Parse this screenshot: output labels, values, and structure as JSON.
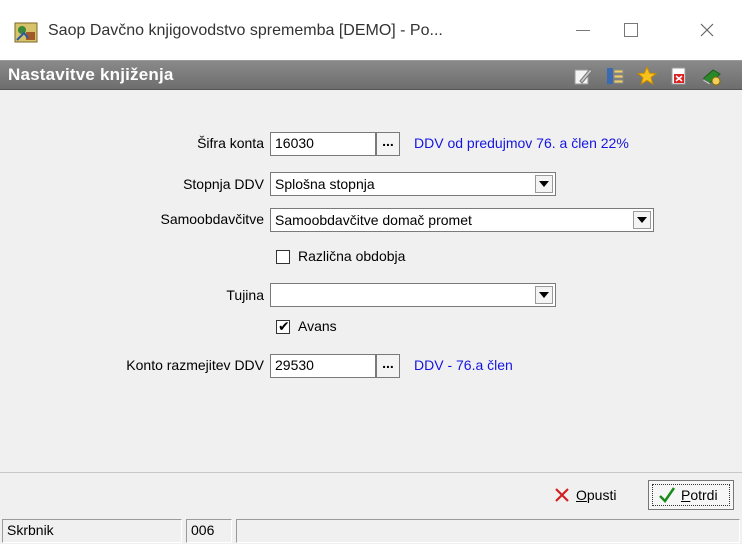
{
  "window": {
    "title": "Saop Davčno knjigovodstvo sprememba [DEMO] - Po...",
    "app_icon": "saop-app-icon"
  },
  "header": {
    "title": "Nastavitve knjiženja",
    "icons": [
      "edit-note-icon",
      "table-columns-icon",
      "favorite-star-icon",
      "export-pdf-icon",
      "help-book-icon"
    ]
  },
  "form": {
    "sifra_konta": {
      "label": "Šifra konta",
      "value": "16030",
      "info": "DDV od predujmov 76. a člen  22%"
    },
    "stopnja_ddv": {
      "label": "Stopnja DDV",
      "value": "Splošna stopnja"
    },
    "samoobdavcitve": {
      "label": "Samoobdavčitve",
      "value": "Samoobdavčitve domač promet"
    },
    "razlicna_obdobja": {
      "label": "Različna obdobja",
      "checked": false
    },
    "tujina": {
      "label": "Tujina",
      "value": ""
    },
    "avans": {
      "label": "Avans",
      "checked": true,
      "mark": "✔"
    },
    "konto_razmejitev": {
      "label": "Konto razmejitev DDV",
      "value": "29530",
      "info": "DDV - 76.a člen"
    },
    "ellipsis": "..."
  },
  "buttons": {
    "cancel": "Opusti",
    "ok": "Potrdi"
  },
  "status": {
    "user": "Skrbnik",
    "code": "006",
    "extra": ""
  },
  "colors": {
    "header_bg": "#7a7a7a",
    "info_text": "#1515e0",
    "cancel_x": "#d02020",
    "ok_check": "#1a8a1a"
  }
}
